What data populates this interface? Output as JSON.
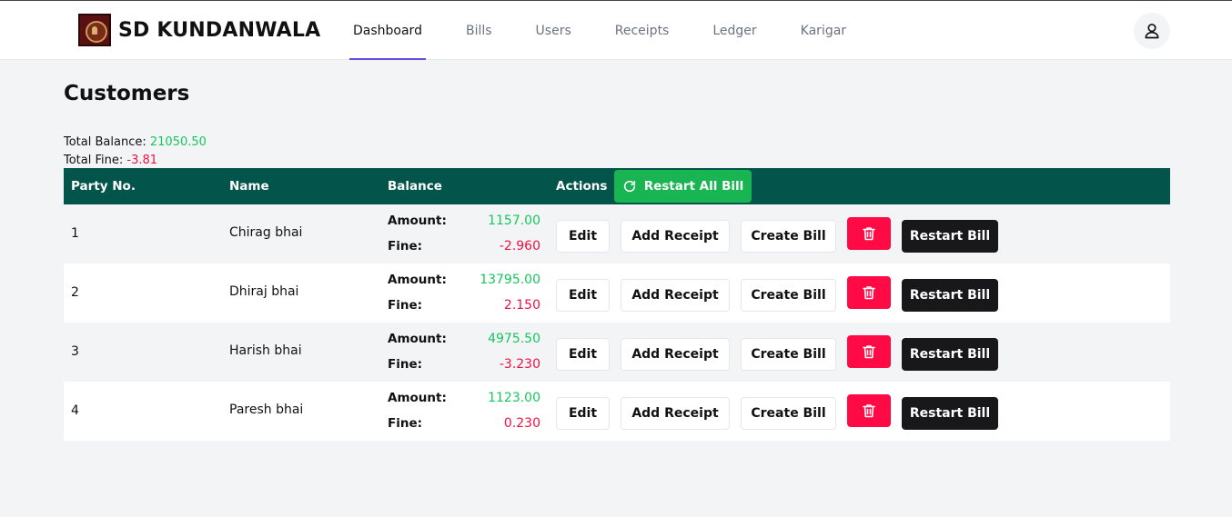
{
  "header": {
    "brand": "SD KUNDANWALA",
    "nav": [
      "Dashboard",
      "Bills",
      "Users",
      "Receipts",
      "Ledger",
      "Karigar"
    ],
    "active_nav": "Dashboard",
    "profile_icon": "user-icon"
  },
  "page": {
    "title": "Customers",
    "total_balance_label": "Total Balance:",
    "total_balance": "21050.50",
    "total_fine_label": "Total Fine:",
    "total_fine": "-3.81"
  },
  "table": {
    "columns": [
      "Party No.",
      "Name",
      "Balance",
      "Actions"
    ],
    "restart_all_label": "Restart All Bill",
    "amount_label": "Amount:",
    "fine_label": "Fine:",
    "actions": {
      "edit": "Edit",
      "add_receipt": "Add Receipt",
      "create_bill": "Create Bill",
      "delete_icon": "trash-icon",
      "restart_bill": "Restart Bill"
    },
    "rows": [
      {
        "party": "1",
        "name": "Chirag bhai",
        "amount": "1157.00",
        "fine": "-2.960"
      },
      {
        "party": "2",
        "name": "Dhiraj bhai",
        "amount": "13795.00",
        "fine": "2.150"
      },
      {
        "party": "3",
        "name": "Harish bhai",
        "amount": "4975.50",
        "fine": "-3.230"
      },
      {
        "party": "4",
        "name": "Paresh bhai",
        "amount": "1123.00",
        "fine": "0.230"
      }
    ]
  },
  "colors": {
    "header_bg": "#03544b",
    "positive": "#16c75e",
    "negative": "#ee1144",
    "delete": "#ff0a45",
    "restart": "#18181b",
    "restart_all": "#18b552",
    "nav_underline": "#6d4ad8"
  }
}
